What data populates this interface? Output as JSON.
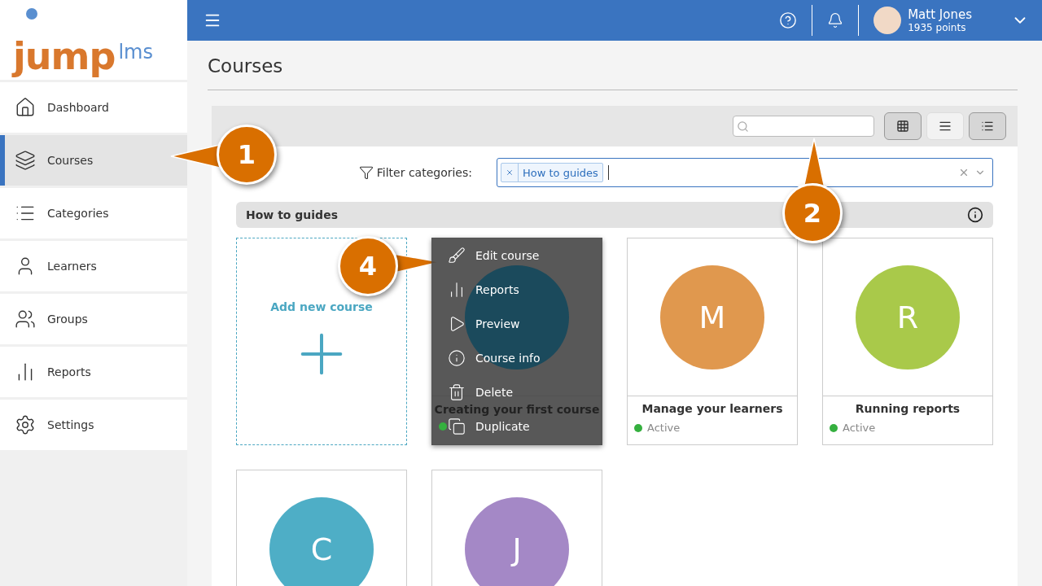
{
  "logo": {
    "main": "jump",
    "suffix": "lms"
  },
  "sidebar": {
    "items": [
      {
        "label": "Dashboard",
        "selected": false
      },
      {
        "label": "Courses",
        "selected": true
      },
      {
        "label": "Categories",
        "selected": false
      },
      {
        "label": "Learners",
        "selected": false
      },
      {
        "label": "Groups",
        "selected": false
      },
      {
        "label": "Reports",
        "selected": false
      },
      {
        "label": "Settings",
        "selected": false
      }
    ]
  },
  "topbar": {
    "user": {
      "name": "Matt Jones",
      "points": "1935 points"
    }
  },
  "page": {
    "title": "Courses"
  },
  "panel": {
    "view_buttons": [
      {
        "selected": true
      },
      {
        "selected": false
      },
      {
        "selected": true
      }
    ],
    "filter": {
      "label": "Filter categories:",
      "tags": [
        "How to guides"
      ]
    },
    "category": {
      "title": "How to guides"
    },
    "cards": [
      {
        "kind": "add",
        "title": "Add new course"
      },
      {
        "kind": "course",
        "color": "#1b4a5c",
        "title": "Creating your first course",
        "active": true,
        "menu": [
          {
            "label": "Edit course"
          },
          {
            "label": "Reports"
          },
          {
            "label": "Preview"
          },
          {
            "label": "Course info"
          },
          {
            "label": "Delete"
          },
          {
            "label": "Duplicate"
          }
        ]
      },
      {
        "kind": "course",
        "letter": "M",
        "color": "#e0984e",
        "title": "Manage your learners",
        "status": "Active",
        "active": true
      },
      {
        "kind": "course",
        "letter": "R",
        "color": "#a9c94a",
        "title": "Running reports",
        "status": "Active",
        "active": true
      },
      {
        "kind": "course",
        "letter": "C",
        "color": "#4eaec6"
      },
      {
        "kind": "course",
        "letter": "J",
        "color": "#a488c6"
      }
    ]
  },
  "callouts": [
    "1",
    "2",
    "4"
  ]
}
